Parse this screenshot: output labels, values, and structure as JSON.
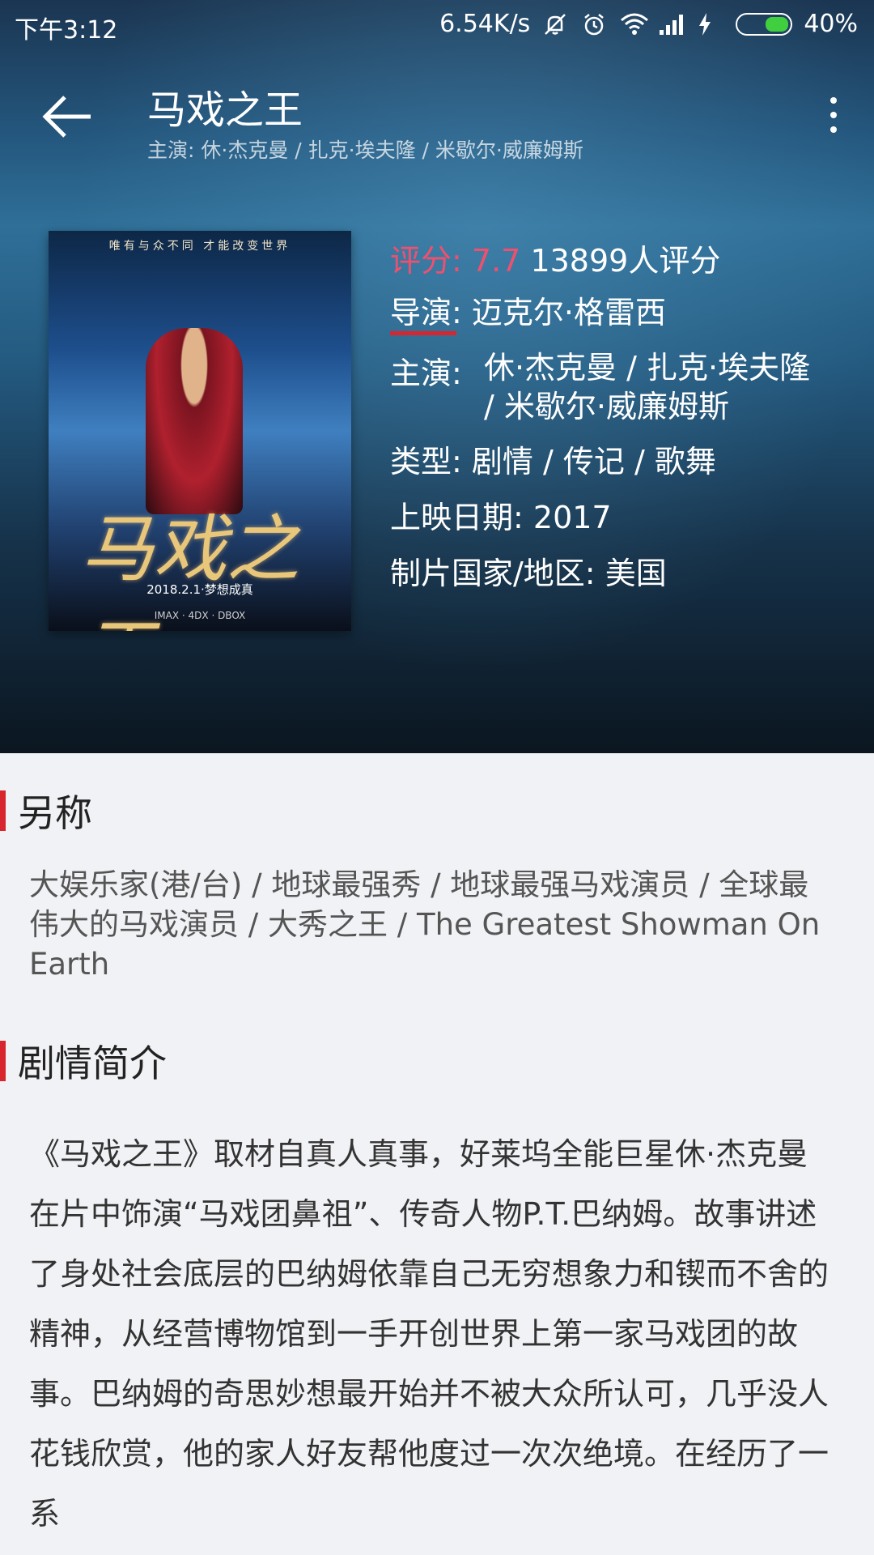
{
  "statusbar": {
    "time": "下午3:12",
    "speed": "6.54K/s",
    "battery": "40%",
    "icons": [
      "mute-icon",
      "alarm-icon",
      "wifi-icon",
      "signal-icon",
      "charging-icon",
      "battery-icon"
    ]
  },
  "header": {
    "title": "马戏之王",
    "subtitle": "主演: 休·杰克曼 / 扎克·埃夫隆 / 米歇尔·威廉姆斯"
  },
  "poster": {
    "tagline": "唯有与众不同 才能改变世界",
    "logo_text": "马戏之王",
    "date_text": "2018.2.1·梦想成真",
    "bottom_text": "IMAX · 4DX · DBOX"
  },
  "info": {
    "rating_label": "评分:",
    "rating_value": "7.7",
    "rating_count": "13899人评分",
    "director_label": "导演:",
    "director_value": "迈克尔·格雷西",
    "cast_label": "主演:",
    "cast_value": "休·杰克曼 / 扎克·埃夫隆 / 米歇尔·威廉姆斯",
    "genre_label": "类型:",
    "genre_value": "剧情 / 传记 / 歌舞",
    "date_label": "上映日期:",
    "date_value": "2017",
    "country_label": "制片国家/地区:",
    "country_value": "美国"
  },
  "alias": {
    "title": "另称",
    "text": "大娱乐家(港/台) / 地球最强秀 / 地球最强马戏演员 / 全球最伟大的马戏演员 / 大秀之王 / The Greatest Showman On Earth"
  },
  "plot": {
    "title": "剧情简介",
    "text": "《马戏之王》取材自真人真事，好莱坞全能巨星休·杰克曼在片中饰演“马戏团鼻祖”、传奇人物P.T.巴纳姆。故事讲述了身处社会底层的巴纳姆依靠自己无穷想象力和锲而不舍的精神，从经营博物馆到一手开创世界上第一家马戏团的故事。巴纳姆的奇思妙想最开始并不被大众所认可，几乎没人花钱欣赏，他的家人好友帮他度过一次次绝境。在经历了一系"
  },
  "colors": {
    "accent": "#d8262f",
    "rating": "#f0506e",
    "background": "#f1f2f5"
  }
}
